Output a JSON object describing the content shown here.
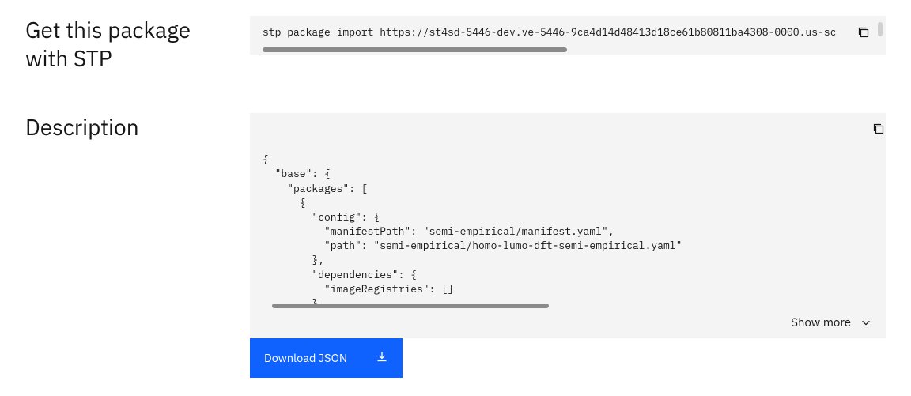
{
  "sections": {
    "stp": {
      "label": "Get this package with STP",
      "code": "stp package import https://st4sd-5446-dev.ve-5446-9ca4d14d48413d18ce61b80811ba4308-0000.us-sc"
    },
    "description": {
      "label": "Description",
      "code": "{\n  \"base\": {\n    \"packages\": [\n      {\n        \"config\": {\n          \"manifestPath\": \"semi-empirical/manifest.yaml\",\n          \"path\": \"semi-empirical/homo-lumo-dft-semi-empirical.yaml\"\n        },\n        \"dependencies\": {\n          \"imageRegistries\": []\n        },\n        \"name\": \"main\",\n        \"source\": {",
      "show_more": "Show more",
      "download_label": "Download JSON"
    }
  }
}
